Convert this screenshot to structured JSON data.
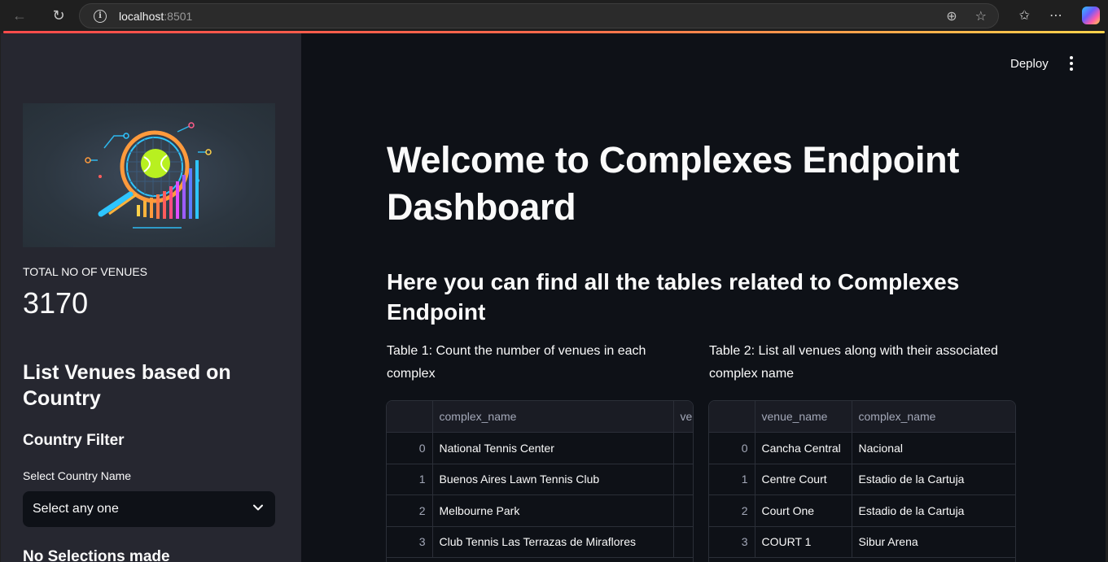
{
  "browser": {
    "url_host": "localhost",
    "url_port": ":8501"
  },
  "header": {
    "deploy_label": "Deploy"
  },
  "sidebar": {
    "metric_label": "TOTAL NO OF VENUES",
    "metric_value": "3170",
    "section_title": "List Venues based on Country",
    "filter_title": "Country Filter",
    "select_label": "Select Country Name",
    "select_value": "Select any one",
    "status_text": "No Selections made"
  },
  "main": {
    "title": "Welcome to Complexes Endpoint Dashboard",
    "subtitle": "Here you can find all the tables related to Complexes Endpoint",
    "table1": {
      "caption": "Table 1: Count the number of venues in each complex",
      "columns": [
        "",
        "complex_name",
        "venue_count"
      ],
      "rows": [
        [
          "0",
          "National Tennis Center",
          ""
        ],
        [
          "1",
          "Buenos Aires Lawn Tennis Club",
          ""
        ],
        [
          "2",
          "Melbourne Park",
          ""
        ],
        [
          "3",
          "Club Tennis Las Terrazas de Miraflores",
          ""
        ]
      ]
    },
    "table2": {
      "caption": "Table 2: List all venues along with their associated complex name",
      "columns": [
        "",
        "venue_name",
        "complex_name"
      ],
      "rows": [
        [
          "0",
          "Cancha Central",
          "Nacional"
        ],
        [
          "1",
          "Centre Court",
          "Estadio de la Cartuja"
        ],
        [
          "2",
          "Court One",
          "Estadio de la Cartuja"
        ],
        [
          "3",
          "COURT 1",
          "Sibur Arena"
        ]
      ]
    }
  }
}
